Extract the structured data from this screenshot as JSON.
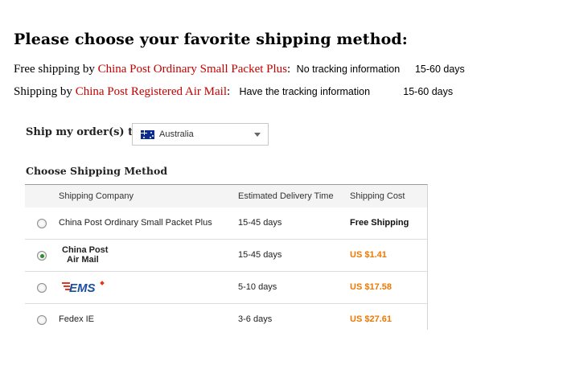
{
  "heading": "Please choose your favorite shipping method:",
  "line1": {
    "prefix": "Free shipping by ",
    "carrier": "China Post Ordinary Small Packet Plus",
    "colon": ":",
    "tracking": "No tracking information",
    "days": "15-60 days"
  },
  "line2": {
    "prefix": "Shipping by ",
    "carrier": "China Post Registered Air Mail",
    "colon": ":",
    "tracking": "Have the tracking information",
    "days": "15-60 days"
  },
  "ship_to": {
    "label": "Ship my order(s) to:",
    "selected_country": "Australia",
    "flag_icon": "australia-flag-icon"
  },
  "method_title": "Choose Shipping Method",
  "table": {
    "headers": {
      "company": "Shipping Company",
      "delivery": "Estimated Delivery Time",
      "cost": "Shipping Cost"
    },
    "rows": [
      {
        "company": "China Post Ordinary Small Packet Plus",
        "delivery": "15-45 days",
        "cost": "Free Shipping",
        "selected": false
      },
      {
        "company_logo_line1": "China Post",
        "company_logo_line2": "Air Mail",
        "delivery": "15-45 days",
        "cost": "US $1.41",
        "selected": true
      },
      {
        "company_logo": "EMS",
        "delivery": "5-10 days",
        "cost": "US $17.58",
        "selected": false
      },
      {
        "company": "Fedex IE",
        "delivery": "3-6 days",
        "cost": "US $27.61",
        "selected": false
      }
    ]
  },
  "colors": {
    "carrier_red": "#c40000",
    "cost_orange": "#f07800",
    "radio_checked": "#2e8b2e",
    "ems_blue": "#1b4fa3",
    "ems_red": "#e8341c"
  }
}
